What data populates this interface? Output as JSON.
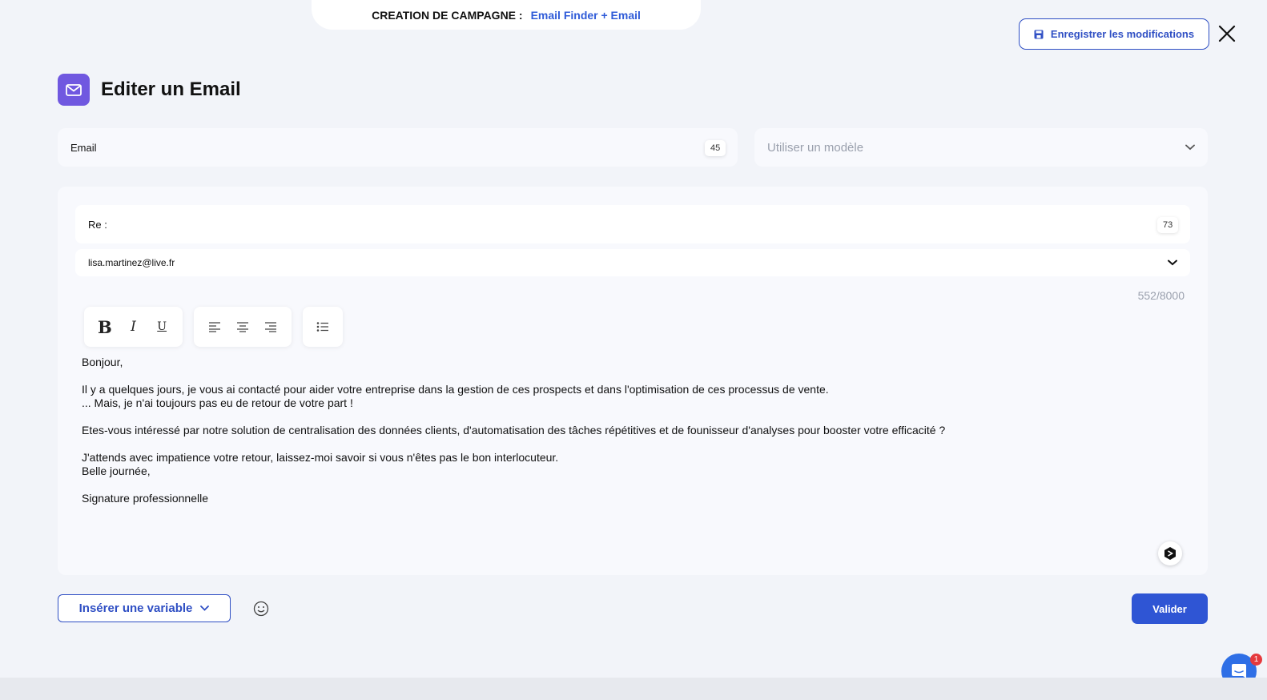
{
  "header": {
    "campaign_label": "CREATION DE CAMPAGNE :",
    "campaign_name": "Email Finder + Email",
    "save_label": "Enregistrer les modifications"
  },
  "page": {
    "title": "Editer un Email"
  },
  "form": {
    "name_value": "Email",
    "name_counter": "45",
    "template_placeholder": "Utiliser un modèle"
  },
  "editor": {
    "subject_value": "Re :",
    "subject_counter": "73",
    "sender_value": "lisa.martinez@live.fr",
    "char_count": "552/8000",
    "body": {
      "greeting": "Bonjour,",
      "line1": "Il y a quelques jours, je vous ai contacté pour aider votre entreprise dans la gestion de ces prospects et dans l'optimisation de ces processus de vente.",
      "line2": "... Mais, je n'ai toujours pas eu de retour de votre part !",
      "line3": "Etes-vous intéressé par notre solution de centralisation des données clients, d'automatisation des tâches répétitives et de founisseur d'analyses pour booster votre efficacité ?",
      "line4": "J'attends avec impatience votre retour, laissez-moi savoir si vous n'êtes pas le bon interlocuteur.",
      "line5": "Belle journée,",
      "signature": "Signature professionnelle"
    },
    "toolbar": {
      "bold": "B",
      "italic": "I",
      "underline": "U"
    }
  },
  "footer": {
    "insert_variable": "Insérer une variable",
    "validate": "Valider",
    "chat_badge": "1"
  },
  "colors": {
    "accent": "#2f4fc4",
    "brand_purple": "#7058e0",
    "background": "#f2f4f9"
  }
}
